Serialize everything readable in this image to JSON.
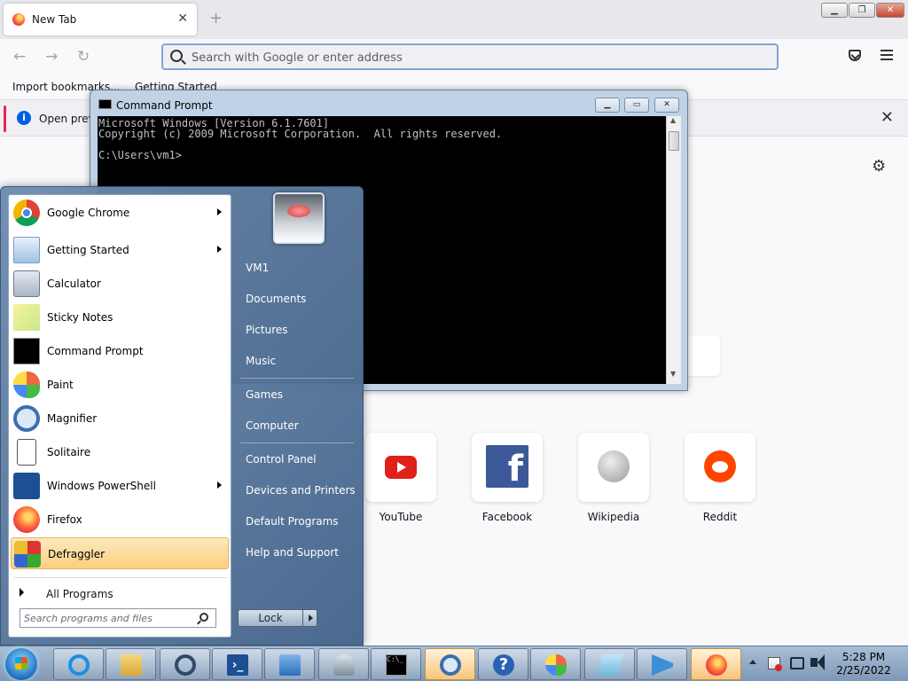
{
  "browser": {
    "tab_title": "New Tab",
    "tab_close": "✕",
    "new_tab": "+",
    "controls": {
      "minimize": "▁",
      "maximize": "❐",
      "close": "✕"
    },
    "nav": {
      "back": "←",
      "forward": "→",
      "reload": "↻"
    },
    "url_placeholder": "Search with Google or enter address",
    "bookmarks": [
      "Import bookmarks...",
      "Getting Started"
    ],
    "infobar_message": "Open previous",
    "infobar_close": "✕",
    "settings": "⚙",
    "shortcuts": [
      {
        "label": "YouTube",
        "icon": "youtube-icon"
      },
      {
        "label": "Facebook",
        "icon": "facebook-icon"
      },
      {
        "label": "Wikipedia",
        "icon": "wikipedia-icon"
      },
      {
        "label": "Reddit",
        "icon": "reddit-icon"
      }
    ],
    "facebook_glyph": "f"
  },
  "cmd": {
    "title": "Command Prompt",
    "controls": {
      "minimize": "▁",
      "maximize": "▭",
      "close": "✕"
    },
    "console_text": "Microsoft Windows [Version 6.1.7601]\nCopyright (c) 2009 Microsoft Corporation.  All rights reserved.\n\nC:\\Users\\vm1>",
    "scroll_up": "▲",
    "scroll_down": "▼"
  },
  "start_menu": {
    "programs": [
      {
        "label": "Google Chrome",
        "icon": "chrome-icon",
        "submenu": true
      },
      {
        "label": "Getting Started",
        "icon": "getting-started-icon",
        "submenu": true
      },
      {
        "label": "Calculator",
        "icon": "calculator-icon",
        "submenu": false
      },
      {
        "label": "Sticky Notes",
        "icon": "sticky-notes-icon",
        "submenu": false
      },
      {
        "label": "Command Prompt",
        "icon": "command-prompt-icon",
        "submenu": false
      },
      {
        "label": "Paint",
        "icon": "paint-icon",
        "submenu": false
      },
      {
        "label": "Magnifier",
        "icon": "magnifier-icon",
        "submenu": false
      },
      {
        "label": "Solitaire",
        "icon": "solitaire-icon",
        "submenu": false
      },
      {
        "label": "Windows PowerShell",
        "icon": "powershell-icon",
        "submenu": true
      },
      {
        "label": "Firefox",
        "icon": "firefox-icon",
        "submenu": false
      },
      {
        "label": "Defraggler",
        "icon": "defraggler-icon",
        "submenu": false,
        "selected": true
      }
    ],
    "all_programs": "All Programs",
    "search_placeholder": "Search programs and files",
    "user_name": "VM1",
    "right_items": [
      "Documents",
      "Pictures",
      "Music",
      "Games",
      "Computer",
      "Control Panel",
      "Devices and Printers",
      "Default Programs",
      "Help and Support"
    ],
    "lock_label": "Lock"
  },
  "taskbar": {
    "ps_glyph": "›_",
    "help_glyph": "?",
    "cmd_glyph": "C:\\_",
    "time": "5:28 PM",
    "date": "2/25/2022"
  },
  "colors": {
    "firefox_accent": "#0060df",
    "infobar_accent": "#e22850",
    "selected_item": "#fbcf7e"
  }
}
